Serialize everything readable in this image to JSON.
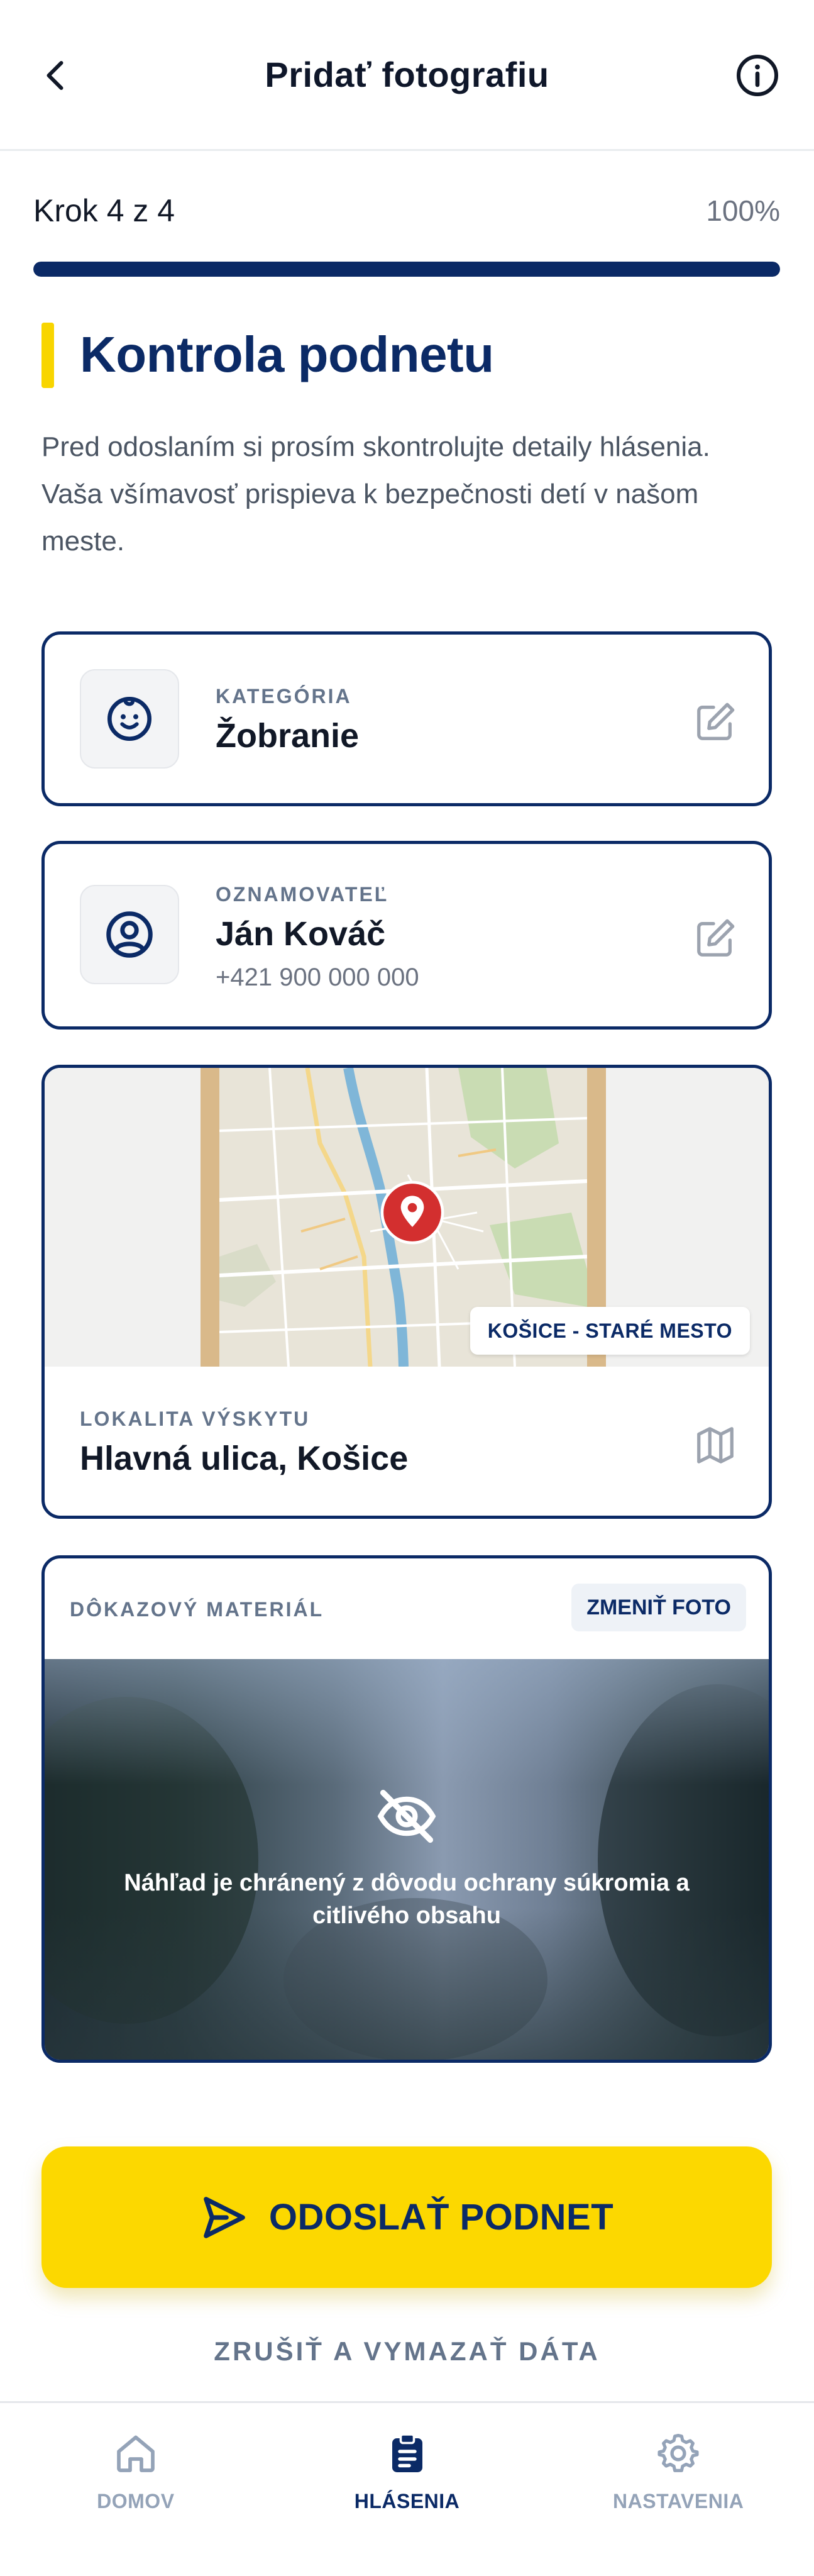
{
  "header": {
    "title": "Pridať fotografiu"
  },
  "step": {
    "label": "Krok 4 z 4",
    "percent_text": "100%",
    "progress": 1.0
  },
  "section": {
    "title": "Kontrola podnetu",
    "intro": "Pred odoslaním si prosím skontrolujte detaily hlásenia. Vaša všímavosť prispieva k bezpečnosti detí v našom meste."
  },
  "category": {
    "label": "KATEGÓRIA",
    "value": "Žobranie",
    "icon": "child-face-icon"
  },
  "reporter": {
    "label": "OZNAMOVATEĽ",
    "name": "Ján Kováč",
    "phone": "+421 900 000 000",
    "icon": "user-circle-icon"
  },
  "location": {
    "badge": "KOŠICE - STARÉ MESTO",
    "label": "LOKALITA VÝSKYTU",
    "value": "Hlavná ulica, Košice"
  },
  "evidence": {
    "label": "DÔKAZOVÝ MATERIÁL",
    "change_button": "ZMENIŤ FOTO",
    "privacy_notice": "Náhľad je chránený z dôvodu ochrany súkromia a citlivého obsahu"
  },
  "actions": {
    "submit": "ODOSLAŤ PODNET",
    "cancel": "ZRUŠIŤ A VYMAZAŤ DÁTA"
  },
  "nav": {
    "items": [
      {
        "label": "DOMOV",
        "icon": "home-icon",
        "active": false
      },
      {
        "label": "HLÁSENIA",
        "icon": "clipboard-icon",
        "active": true
      },
      {
        "label": "NASTAVENIA",
        "icon": "gear-icon",
        "active": false
      }
    ]
  },
  "colors": {
    "primary": "#0b2a66",
    "accent": "#fcd800",
    "pin": "#d32f2f"
  }
}
